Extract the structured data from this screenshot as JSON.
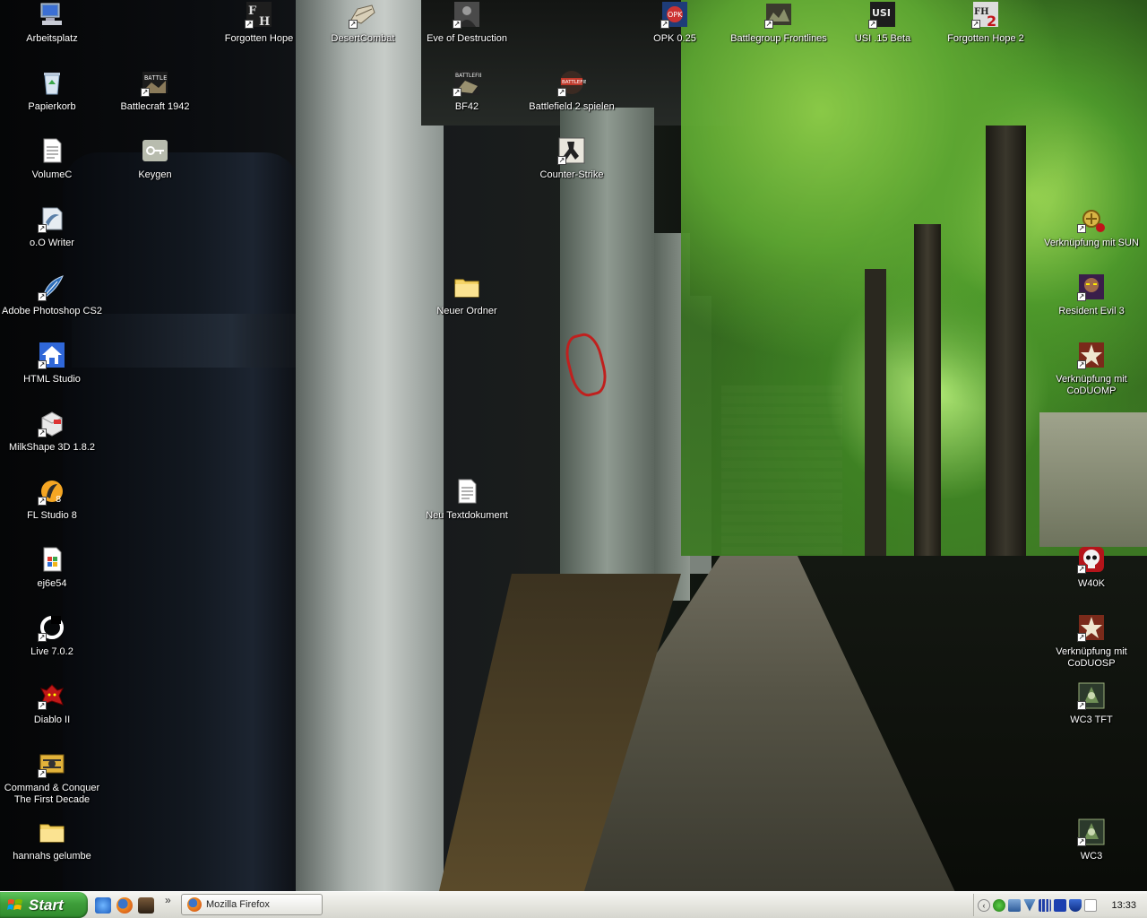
{
  "desktop": {
    "icons": [
      {
        "label": "Arbeitsplatz",
        "icon": "computer-icon",
        "shortcut": false
      },
      {
        "label": "Papierkorb",
        "icon": "recycle-bin-icon",
        "shortcut": false
      },
      {
        "label": "VolumeC",
        "icon": "text-document-icon",
        "shortcut": false
      },
      {
        "label": "o.O Writer",
        "icon": "writer-icon",
        "shortcut": true
      },
      {
        "label": "Adobe Photoshop CS2",
        "icon": "photoshop-feather-icon",
        "shortcut": true
      },
      {
        "label": "HTML Studio",
        "icon": "html-studio-house-icon",
        "shortcut": true
      },
      {
        "label": "MilkShape 3D 1.8.2",
        "icon": "milkshape-icon",
        "shortcut": true
      },
      {
        "label": "FL Studio 8",
        "icon": "fl-studio-icon",
        "shortcut": true
      },
      {
        "label": "ej6e54",
        "icon": "document-icon",
        "shortcut": false
      },
      {
        "label": "Live 7.0.2",
        "icon": "ableton-live-icon",
        "shortcut": true
      },
      {
        "label": "Diablo II",
        "icon": "diablo-icon",
        "shortcut": true
      },
      {
        "label": "Command & Conquer\nThe First Decade",
        "icon": "command-conquer-icon",
        "shortcut": true
      },
      {
        "label": "hannahs gelumbe",
        "icon": "folder-icon",
        "shortcut": false
      },
      {
        "label": "Battlecraft 1942",
        "icon": "battlecraft-icon",
        "shortcut": true
      },
      {
        "label": "Keygen",
        "icon": "key-icon",
        "shortcut": false
      },
      {
        "label": "Forgotten Hope",
        "icon": "forgotten-hope-icon",
        "shortcut": true
      },
      {
        "label": "DesertCombat",
        "icon": "desert-combat-icon",
        "shortcut": true
      },
      {
        "label": "Eve of Destruction",
        "icon": "eve-of-destruction-icon",
        "shortcut": true
      },
      {
        "label": "BF42",
        "icon": "bf42-icon",
        "shortcut": true
      },
      {
        "label": "Neuer Ordner",
        "icon": "folder-icon",
        "shortcut": false
      },
      {
        "label": "Neu Textdokument",
        "icon": "text-document-icon",
        "shortcut": false
      },
      {
        "label": "Battlefield 2 spielen",
        "icon": "battlefield2-icon",
        "shortcut": true
      },
      {
        "label": "Counter-Strike",
        "icon": "counter-strike-icon",
        "shortcut": true
      },
      {
        "label": "OPK 0.25",
        "icon": "opk-icon",
        "shortcut": true
      },
      {
        "label": "Battlegroup Frontlines",
        "icon": "battlegroup-icon",
        "shortcut": true
      },
      {
        "label": "USI .15 Beta",
        "icon": "usi-icon",
        "shortcut": true
      },
      {
        "label": "Forgotten Hope 2",
        "icon": "forgotten-hope-2-icon",
        "shortcut": true
      },
      {
        "label": "Verknüpfung mit SUN",
        "icon": "sun-icon",
        "shortcut": true
      },
      {
        "label": "Resident Evil 3",
        "icon": "resident-evil-icon",
        "shortcut": true
      },
      {
        "label": "Verknüpfung mit\nCoDUOMP",
        "icon": "cod-star-icon",
        "shortcut": true
      },
      {
        "label": "W40K",
        "icon": "skull-icon",
        "shortcut": true
      },
      {
        "label": "Verknüpfung mit\nCoDUOSP",
        "icon": "cod-star-icon",
        "shortcut": true
      },
      {
        "label": "WC3 TFT",
        "icon": "warcraft3-icon",
        "shortcut": true
      },
      {
        "label": "WC3",
        "icon": "warcraft3-icon",
        "shortcut": true
      }
    ]
  },
  "taskbar": {
    "start_label": "Start",
    "quick_launch": [
      "internet-explorer-icon",
      "firefox-icon",
      "game-icon"
    ],
    "chevron": "»",
    "tasks": [
      {
        "label": "Mozilla Firefox",
        "icon": "firefox-icon"
      }
    ],
    "tray_expand": "‹",
    "tray_icons": [
      "clover-icon",
      "network-icon",
      "antivirus-icon",
      "signal-icon",
      "media-icon",
      "shield-icon",
      "blank-icon"
    ],
    "clock": "13:33"
  },
  "colors": {
    "start_green": "#3e9d3a",
    "taskbar_silver": "#e8e8e2",
    "label_text": "#ffffff"
  }
}
